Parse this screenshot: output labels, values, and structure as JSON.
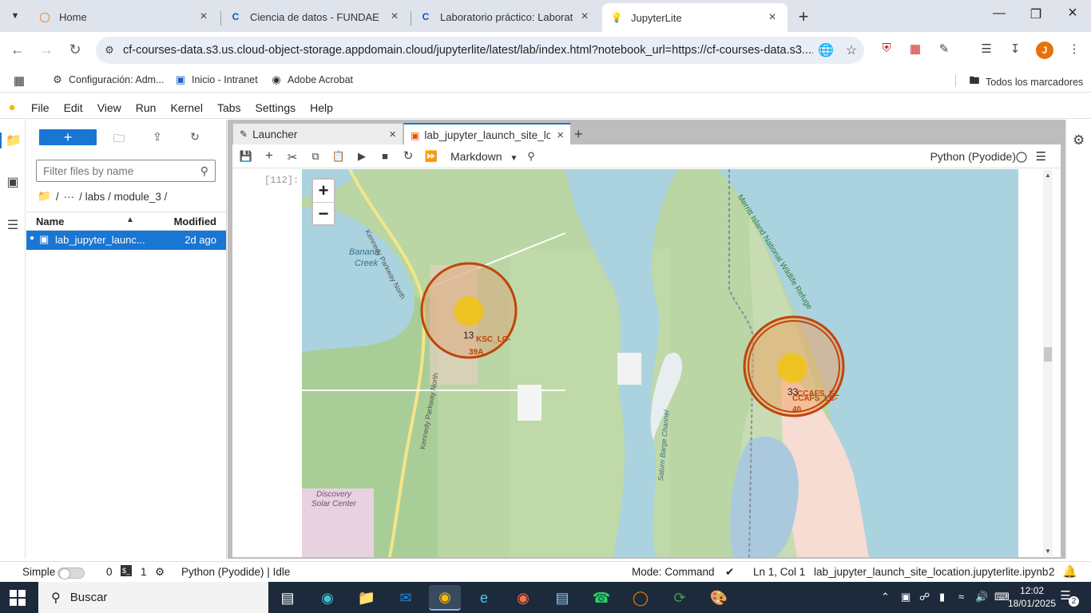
{
  "browser": {
    "tabs": [
      {
        "title": "Home",
        "icon": "orange-ring-icon",
        "active": false
      },
      {
        "title": "Ciencia de datos - FUNDAE | Co",
        "icon": "coursera-icon",
        "active": false
      },
      {
        "title": "Laboratorio práctico: Laborator",
        "icon": "coursera-icon",
        "active": false
      },
      {
        "title": "JupyterLite",
        "icon": "jupyterlite-icon",
        "active": true
      }
    ],
    "url": "cf-courses-data.s3.us.cloud-object-storage.appdomain.cloud/jupyterlite/latest/lab/index.html?notebook_url=https://cf-courses-data.s3....",
    "avatar_letter": "J",
    "bookmarks": [
      {
        "label": "Configuración: Adm...",
        "icon": "gear-icon"
      },
      {
        "label": "Inicio - Intranet",
        "icon": "intranet-icon"
      },
      {
        "label": "Adobe Acrobat",
        "icon": "acrobat-icon"
      }
    ],
    "all_bookmarks": "Todos los marcadores"
  },
  "jupyter": {
    "menu": [
      "File",
      "Edit",
      "View",
      "Run",
      "Kernel",
      "Tabs",
      "Settings",
      "Help"
    ],
    "filebrowser": {
      "new_label": "+",
      "filter_placeholder": "Filter files by name",
      "breadcrumbs": [
        "/",
        "···",
        "/ labs / module_3 /"
      ],
      "col_name": "Name",
      "col_modified": "Modified",
      "files": [
        {
          "name": "lab_jupyter_launc...",
          "modified": "2d ago"
        }
      ]
    },
    "dock_tabs": [
      {
        "title": "Launcher",
        "icon": "launcher-icon",
        "active": false
      },
      {
        "title": "lab_jupyter_launch_site_locat",
        "icon": "notebook-icon",
        "active": true
      }
    ],
    "toolbar": {
      "cell_type": "Markdown",
      "kernel_name": "Python (Pyodide)"
    },
    "cell_prompt": "[112]:",
    "map": {
      "zoom_in": "+",
      "zoom_out": "−",
      "clusters": [
        {
          "count": "13",
          "label": "KSC_LC-39A"
        },
        {
          "count": "33",
          "label": "CCAFS_SLC-40"
        }
      ],
      "place_labels": {
        "banana_creek_1": "Banana",
        "banana_creek_2": "Creek",
        "kennedy_north": "Kennedy Parkway North",
        "kennedy_south": "Kennedy Parkway North",
        "saturn_barge": "Saturn Barge Channel",
        "refuge": "Merritt Island National Wildlife Refuge",
        "discovery_1": "Discovery",
        "discovery_2": "Solar Center",
        "lc39a_1": "KSC_LC-",
        "lc39a_2": "39A",
        "slc_1": "CCAFS_SL",
        "slc_2": "CCAFS_LC-",
        "slc_3": "40"
      }
    },
    "status": {
      "mode_simple": "Simple",
      "terminals": "0",
      "kernels": "1",
      "kernel_status": "Python (Pyodide) | Idle",
      "mode": "Mode: Command",
      "position": "Ln 1, Col 1",
      "filename": "lab_jupyter_launch_site_location.jupyterlite.ipynb",
      "notifications": "2"
    }
  },
  "taskbar": {
    "search": "Buscar",
    "time": "12:02",
    "date": "18/01/2025",
    "notif_count": "2"
  },
  "colors": {
    "jupyter_blue": "#1976d2",
    "cluster_ring": "#d35400",
    "cluster_fill": "#f0a060",
    "cluster_core": "#f1c40f",
    "water": "#aad3df",
    "land": "#b9d6a4"
  }
}
